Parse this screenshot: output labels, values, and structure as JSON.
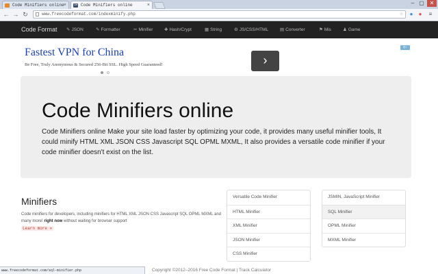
{
  "browser": {
    "tabs": [
      {
        "label": "Code Minifiers online"
      },
      {
        "label": "Code Minifiers online",
        "favicon_text": "CM"
      }
    ],
    "window_controls": {
      "minimize": "–",
      "maximize": "▢",
      "close": "✕"
    },
    "url": "www.freecodeformat.com/indexminify.php",
    "status_url": "www.freecodeformat.com/sql-minifier.php"
  },
  "nav": {
    "brand": "Code Format",
    "items": [
      {
        "icon": "✎",
        "label": "JSON"
      },
      {
        "icon": "✎",
        "label": "Formatter"
      },
      {
        "icon": "✂",
        "label": "Minifier"
      },
      {
        "icon": "✚",
        "label": "Hash/Crypt"
      },
      {
        "icon": "▦",
        "label": "String"
      },
      {
        "icon": "⚙",
        "label": "JS/CSS/HTML"
      },
      {
        "icon": "▤",
        "label": "Converter"
      },
      {
        "icon": "⚑",
        "label": "Mis"
      },
      {
        "icon": "♟",
        "label": "Game"
      }
    ]
  },
  "ad": {
    "title": "Fastest VPN for China",
    "subtitle": "Be Free, Truly Anonymous & Secured 256-Bit SSL. High Speed Guaranteed!",
    "next_glyph": "›",
    "badge": "i▷"
  },
  "hero": {
    "title": "Code Minifiers online",
    "text": "Code Minifiers online Make your site load faster by optimizing your code, it provides many useful minifier tools, It could minify HTML XML JSON CSS Javascript SQL OPML MXML, It also provides a versatile code minifier if your code minifier doesn't exist on the list."
  },
  "minifiers": {
    "title": "Minifiers",
    "text_before": "Code minifiers for developers, including minifiers for HTML XML JSON CSS Javascript SQL OPML MXML and many more! ",
    "text_bold": "right now",
    "text_after": " without waiting for browser support",
    "read_more": "Learn more »",
    "left_list": [
      "Versatile Code Minifier",
      "HTML Minifier",
      "XML Minifier",
      "JSON Minifier",
      "CSS Minifier"
    ],
    "right_list": [
      "JSMIN, JavaScript Minifier",
      "SQL Minifier",
      "OPML Minifier",
      "MXML Minifier"
    ]
  },
  "footer": "Copyright ©2012–2016 Free Code Format | Track Calculator"
}
